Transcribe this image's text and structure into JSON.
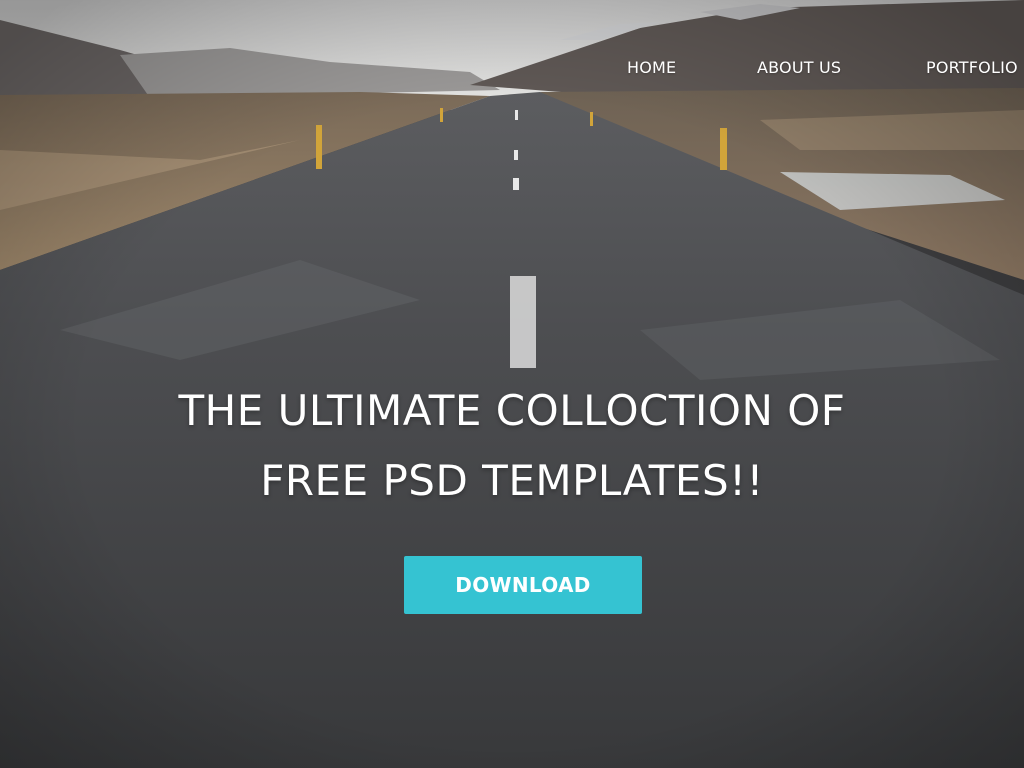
{
  "nav": {
    "items": [
      {
        "label": "HOME"
      },
      {
        "label": "ABOUT US"
      },
      {
        "label": "PORTFOLIO"
      }
    ]
  },
  "hero": {
    "headline_line1": "THE ULTIMATE COLLOCTION OF",
    "headline_line2": "FREE PSD TEMPLATES!!",
    "button_label": "DOWNLOAD",
    "background_image": "road-landscape-photo"
  },
  "colors": {
    "accent": "#35c3d2",
    "text": "#ffffff"
  }
}
